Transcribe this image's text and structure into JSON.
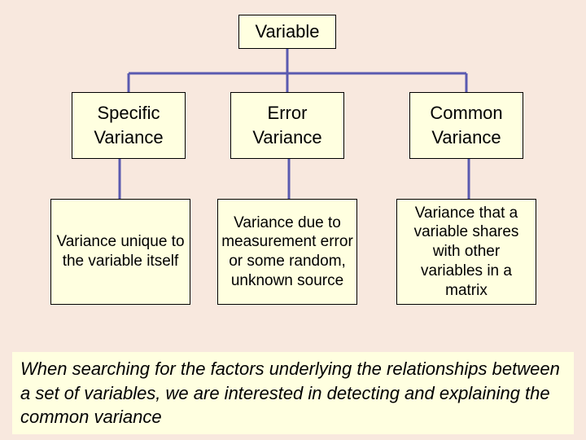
{
  "root": {
    "label": "Variable"
  },
  "col1": {
    "title_line1": "Specific",
    "title_line2": "Variance",
    "desc": "Variance unique to the variable itself"
  },
  "col2": {
    "title_line1": "Error",
    "title_line2": "Variance",
    "desc": "Variance due to measurement error or some random, unknown source"
  },
  "col3": {
    "title_line1": "Common",
    "title_line2": "Variance",
    "desc": "Variance that a variable shares with other variables in a matrix"
  },
  "caption": "When searching for the factors underlying the relationships between a set of variables, we are interested in detecting and explaining the common variance",
  "colors": {
    "background": "#f8e8de",
    "box_fill": "#ffffe0",
    "connector": "#5a5ab0"
  }
}
